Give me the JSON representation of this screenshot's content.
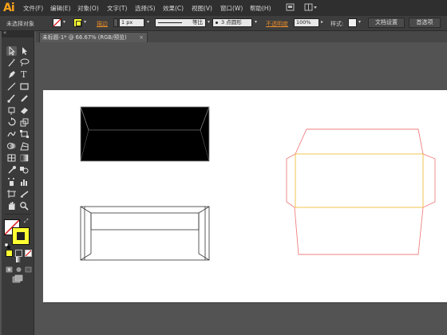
{
  "app": {
    "logo": "Ai"
  },
  "menubar": {
    "items": [
      "文件(F)",
      "编辑(E)",
      "对象(O)",
      "文字(T)",
      "选择(S)",
      "效果(C)",
      "视图(V)",
      "窗口(W)",
      "帮助(H)"
    ]
  },
  "control": {
    "selection_label": "未选择对象",
    "stroke_label": "描边",
    "stroke_weight": "1 px",
    "stroke_profile": "等比",
    "brush": "3 点圆形",
    "opacity_label": "不透明度",
    "opacity_value": "100%",
    "style_label": "样式:",
    "doc_setup_button": "文档设置",
    "prefs_button": "首选项"
  },
  "document": {
    "tab_title": "未标题-1* @ 66.67% (RGB/预览)",
    "tab_close": "×"
  },
  "colors": {
    "logo": "#f7a21b",
    "fill": "#ffff33",
    "stroke_outline_red": "#f08080",
    "fold_line_yellow": "#f0c040",
    "artboard": "#ffffff",
    "envelope_filled": "#000000"
  },
  "icons": {
    "selection": "selection-arrow-icon",
    "direct_selection": "direct-selection-icon",
    "magic_wand": "magic-wand-icon",
    "lasso": "lasso-icon",
    "pen": "pen-icon",
    "type": "type-icon",
    "line": "line-segment-icon",
    "rectangle": "rectangle-icon",
    "paintbrush": "paintbrush-icon",
    "pencil": "pencil-icon",
    "blob_brush": "blob-brush-icon",
    "eraser": "eraser-icon",
    "rotate": "rotate-icon",
    "scale": "scale-icon",
    "warp": "warp-icon",
    "free_transform": "free-transform-icon",
    "shape_builder": "shape-builder-icon",
    "perspective": "perspective-grid-icon",
    "mesh": "mesh-icon",
    "gradient": "gradient-icon",
    "eyedropper": "eyedropper-icon",
    "blend": "blend-icon",
    "symbol_sprayer": "symbol-sprayer-icon",
    "graph": "column-graph-icon",
    "artboard": "artboard-icon",
    "slice": "slice-icon",
    "hand": "hand-icon",
    "zoom": "zoom-icon"
  }
}
